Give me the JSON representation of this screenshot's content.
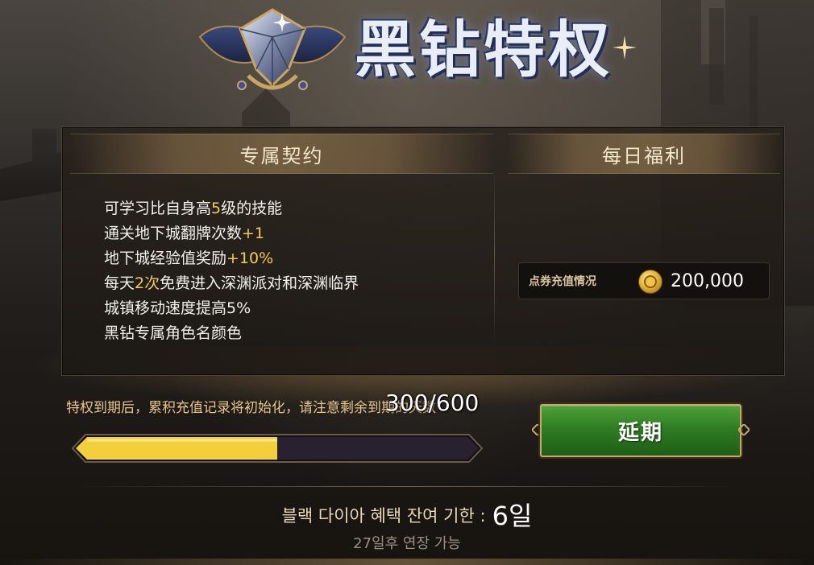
{
  "title": "黑钻特权",
  "left_column": {
    "header": "专属契约",
    "perks": [
      {
        "pre": "可学习比自身高",
        "hl": "5",
        "post": "级的技能"
      },
      {
        "pre": "通关地下城翻牌次数",
        "hl": "+1",
        "post": ""
      },
      {
        "pre": "地下城经验值奖励",
        "hl": "+10%",
        "post": ""
      },
      {
        "pre": "每天",
        "hl": "2次",
        "post": "免费进入深渊派对和深渊临界"
      },
      {
        "pre": "城镇移动速度提高5%",
        "hl": "",
        "post": ""
      },
      {
        "pre": "黑钻专属角色名颜色",
        "hl": "",
        "post": ""
      }
    ]
  },
  "right_column": {
    "header": "每日福利",
    "recharge_label": "点券充值情况",
    "recharge_value": "200,000"
  },
  "notice": "特权到期后，累积充值记录将初始化，请注意剩余到期的天数",
  "progress": {
    "text": "300/600",
    "current": 300,
    "max": 600
  },
  "extend_button": "延期",
  "expiry": {
    "label": "블랙 다이아 혜택 잔여 기한 :",
    "days": "6일"
  },
  "extend_note": "27일후 연장 가능",
  "colors": {
    "highlight": "#f0cc55",
    "button_green": "#2f7d23",
    "progress_fill": "#f4cf3c",
    "progress_track": "#2a2130"
  },
  "icons": {
    "emblem": "black-diamond-emblem-icon",
    "coin": "coupon-coin-icon"
  }
}
